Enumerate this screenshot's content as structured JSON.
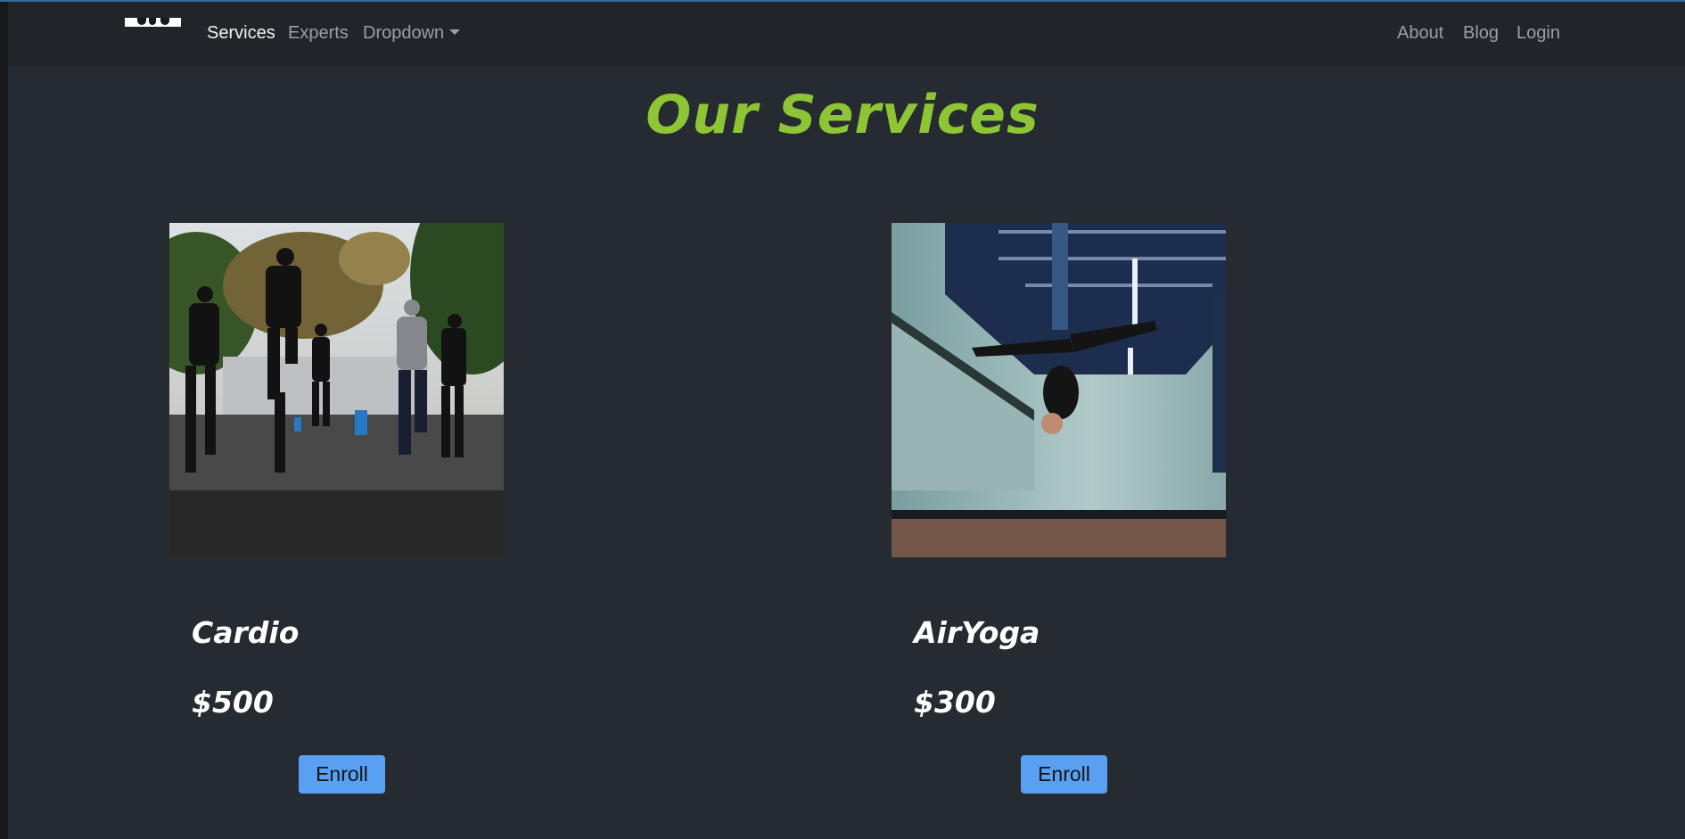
{
  "nav": {
    "left_items": [
      "Services",
      "Experts",
      "Dropdown"
    ],
    "right_items": [
      "About",
      "Blog",
      "Login"
    ],
    "active_item": "Services"
  },
  "page": {
    "title": "Our Services"
  },
  "services": [
    {
      "name": "Cardio",
      "price": "$500",
      "button": "Enroll",
      "image": "group-running-outdoors-photo"
    },
    {
      "name": "AirYoga",
      "price": "$300",
      "button": "Enroll",
      "image": "aerial-yoga-studio-photo"
    }
  ],
  "colors": {
    "background": "#262a31",
    "navbar": "#212428",
    "title_green": "#8dc534",
    "button_blue": "#5aa0f2"
  }
}
